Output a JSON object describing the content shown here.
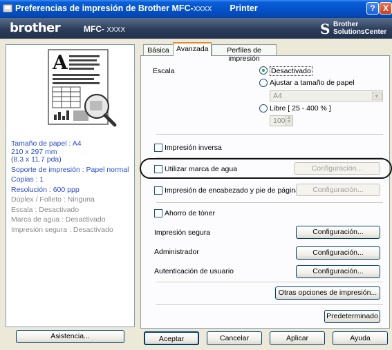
{
  "window": {
    "title": "Preferencias de impresión de Brother MFC-",
    "title_model": "XXXX",
    "title_suffix": "Printer",
    "help_label": "?",
    "close_label": "X"
  },
  "brandbar": {
    "logo_text": "brother",
    "model_prefix": "MFC-",
    "model_suffix": "XXXX",
    "solutions_line1": "Brother",
    "solutions_line2": "SolutionsCenter"
  },
  "preview": {
    "paper_size": "Tamaño de papel : A4",
    "paper_mm": "210 x 297 mm",
    "paper_in": "(8.3 x 11.7 pda)",
    "media": "Soporte de impresión : Papel normal",
    "copies": "Copias : 1",
    "resolution": "Resolución : 600 ppp",
    "duplex": "Dúplex / Folleto : Ninguna",
    "scale": "Escala : Desactivado",
    "watermark": "Marca de agua : Desactivado",
    "secure_print": "Impresión segura : Desactivado"
  },
  "tabs": [
    {
      "label": "Básica",
      "active": false
    },
    {
      "label": "Avanzada",
      "active": true
    },
    {
      "label": "Perfiles de impresión",
      "active": false
    }
  ],
  "advanced": {
    "scale_label": "Escala",
    "scale_off": "Desactivado",
    "scale_fit": "Ajustar a tamaño de papel",
    "fit_size_value": "A4",
    "scale_free": "Libre [ 25 - 400 % ]",
    "free_value": "100",
    "reverse_print": "Impresión inversa",
    "watermark": "Utilizar marca de agua",
    "watermark_config": "Configuración...",
    "header_footer": "Impresión de encabezado y pie de página",
    "header_footer_config": "Configuración...",
    "toner_save": "Ahorro de tóner",
    "secure_print": "Impresión segura",
    "secure_print_config": "Configuración...",
    "administrator": "Administrador",
    "administrator_config": "Configuración...",
    "user_auth": "Autenticación de usuario",
    "user_auth_config": "Configuración...",
    "other_options": "Otras opciones de impresión...",
    "default": "Predeterminado"
  },
  "footer": {
    "help": "Asistencia...",
    "ok": "Aceptar",
    "cancel": "Cancelar",
    "apply": "Aplicar",
    "help2": "Ayuda"
  }
}
